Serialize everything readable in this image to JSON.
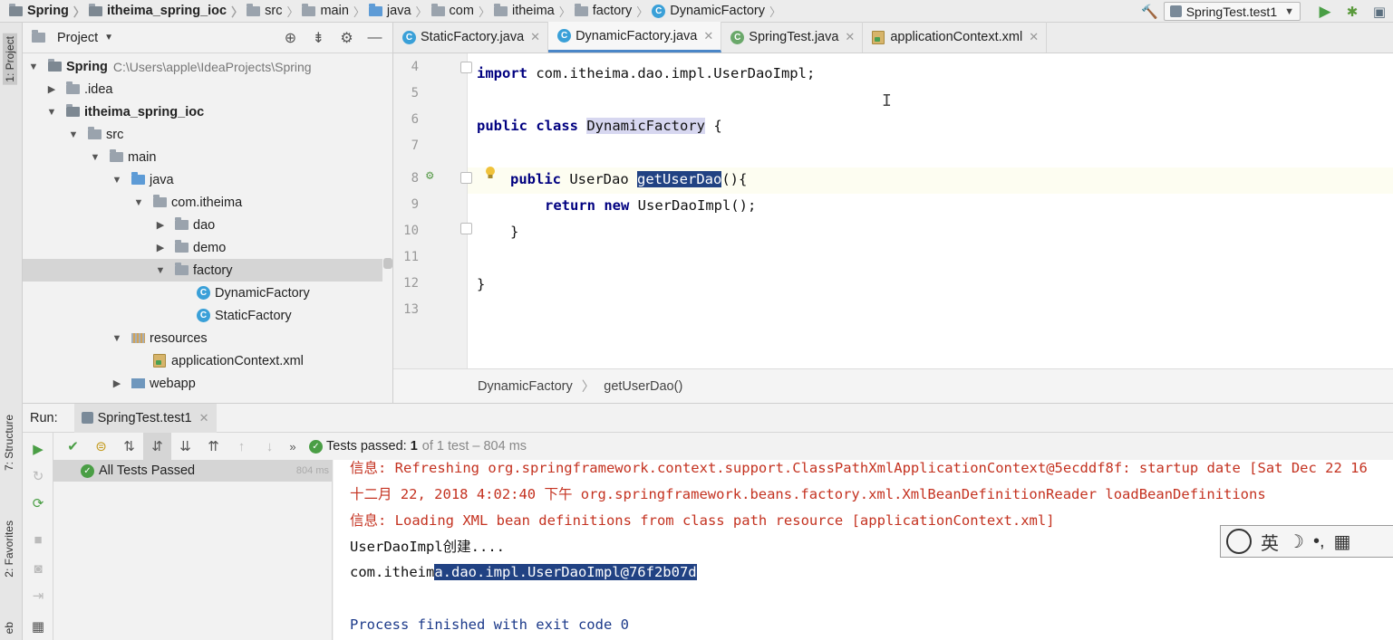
{
  "breadcrumbs": [
    "Spring",
    "itheima_spring_ioc",
    "src",
    "main",
    "java",
    "com",
    "itheima",
    "factory",
    "DynamicFactory"
  ],
  "run_config": "SpringTest.test1",
  "left_strip": {
    "project_tab": "1: Project",
    "structure_tab": "7: Structure",
    "favorites_tab": "2: Favorites",
    "web_tab": "eb"
  },
  "project_panel": {
    "title": "Project",
    "tree": [
      {
        "label": "Spring",
        "path": "C:\\Users\\apple\\IdeaProjects\\Spring"
      },
      {
        "label": ".idea"
      },
      {
        "label": "itheima_spring_ioc"
      },
      {
        "label": "src"
      },
      {
        "label": "main"
      },
      {
        "label": "java"
      },
      {
        "label": "com.itheima"
      },
      {
        "label": "dao"
      },
      {
        "label": "demo"
      },
      {
        "label": "factory"
      },
      {
        "label": "DynamicFactory"
      },
      {
        "label": "StaticFactory"
      },
      {
        "label": "resources"
      },
      {
        "label": "applicationContext.xml"
      },
      {
        "label": "webapp"
      }
    ]
  },
  "editor": {
    "tabs": [
      "StaticFactory.java",
      "DynamicFactory.java",
      "SpringTest.java",
      "applicationContext.xml"
    ],
    "active_tab": "DynamicFactory.java",
    "line_numbers": [
      "4",
      "5",
      "6",
      "7",
      "8",
      "9",
      "10",
      "11",
      "12",
      "13"
    ],
    "code": {
      "l4_kw": "import",
      "l4_rest": " com.itheima.dao.impl.UserDaoImpl;",
      "l6_kw": "public class",
      "l6_name": "DynamicFactory",
      "l6_rest": " {",
      "l8_kw": "public",
      "l8_type": " UserDao ",
      "l8_method": "getUserDao",
      "l8_rest": "(){",
      "l9_kw": "return new",
      "l9_rest": " UserDaoImpl();",
      "l10": "}",
      "l12": "}"
    },
    "breadcrumb": [
      "DynamicFactory",
      "getUserDao()"
    ]
  },
  "run_panel": {
    "label": "Run:",
    "tab": "SpringTest.test1",
    "status_prefix": "Tests passed:",
    "status_count": "1",
    "status_suffix": "of 1 test – 804 ms",
    "tree_item": "All Tests Passed",
    "tree_time": "804 ms",
    "console": {
      "line1": "信息: Refreshing org.springframework.context.support.ClassPathXmlApplicationContext@5ecddf8f: startup date [Sat Dec 22 16",
      "line2": "十二月 22, 2018 4:02:40 下午 org.springframework.beans.factory.xml.XmlBeanDefinitionReader loadBeanDefinitions",
      "line3": "信息: Loading XML bean definitions from class path resource [applicationContext.xml]",
      "line4": "UserDaoImpl创建....",
      "line5_a": "com.itheim",
      "line5_b": "a.dao.impl.UserDaoImpl@76f2b07d",
      "line6": "Process finished with exit code 0"
    }
  },
  "ime": {
    "lang": "英"
  },
  "colors": {
    "keyword": "#000080",
    "selection": "#214283",
    "console_error": "#c43220",
    "pass": "#4a9e45"
  }
}
